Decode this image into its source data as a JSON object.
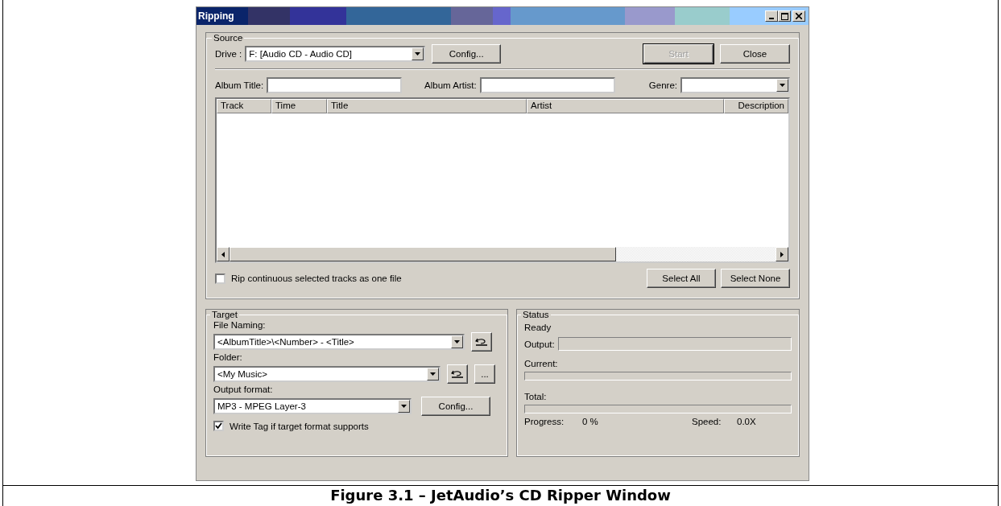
{
  "window": {
    "title": "Ripping"
  },
  "source": {
    "label": "Source",
    "drive_label": "Drive :",
    "drive": "F:  [Audio CD - Audio CD]",
    "config_button": "Config...",
    "buttons": [
      {
        "label": "Start",
        "disabled": true
      },
      {
        "label": "Close",
        "disabled": false
      }
    ],
    "album_title_label": "Album Title:",
    "album_artist_label": "Album Artist:",
    "genre_label": "Genre:",
    "table": {
      "columns": [
        "Track",
        "Time",
        "Title",
        "Artist",
        "Description"
      ]
    },
    "rip_as_one": {
      "label": "Rip continuous selected tracks as one file",
      "checked": false
    },
    "select_buttons": [
      "Select All",
      "Select None"
    ]
  },
  "target": {
    "label": "Target",
    "file_naming_label": "File Naming:",
    "file_naming": "<AlbumTitle>\\<Number> - <Title>",
    "folder_label": "Folder:",
    "folder": "<My Music>",
    "browse_button": "...",
    "output_format_label": "Output format:",
    "output_format": "MP3 - MPEG Layer-3",
    "config_button": "Config...",
    "write_tag": {
      "label": "Write Tag if target format supports",
      "checked": true
    }
  },
  "status": {
    "label": "Status",
    "state": "Ready",
    "meters": [
      {
        "label": "Output:",
        "level": 0,
        "kind": "inline"
      },
      {
        "label": "Current:",
        "level": 0,
        "kind": "stacked"
      },
      {
        "label": "Total:",
        "level": 0,
        "kind": "stacked"
      }
    ],
    "progress_label": "Progress:",
    "progress": "0 %",
    "speed_label": "Speed:",
    "speed": "0.0X"
  },
  "caption": "Figure 3.1 – JetAudio’s CD Ripper Window"
}
